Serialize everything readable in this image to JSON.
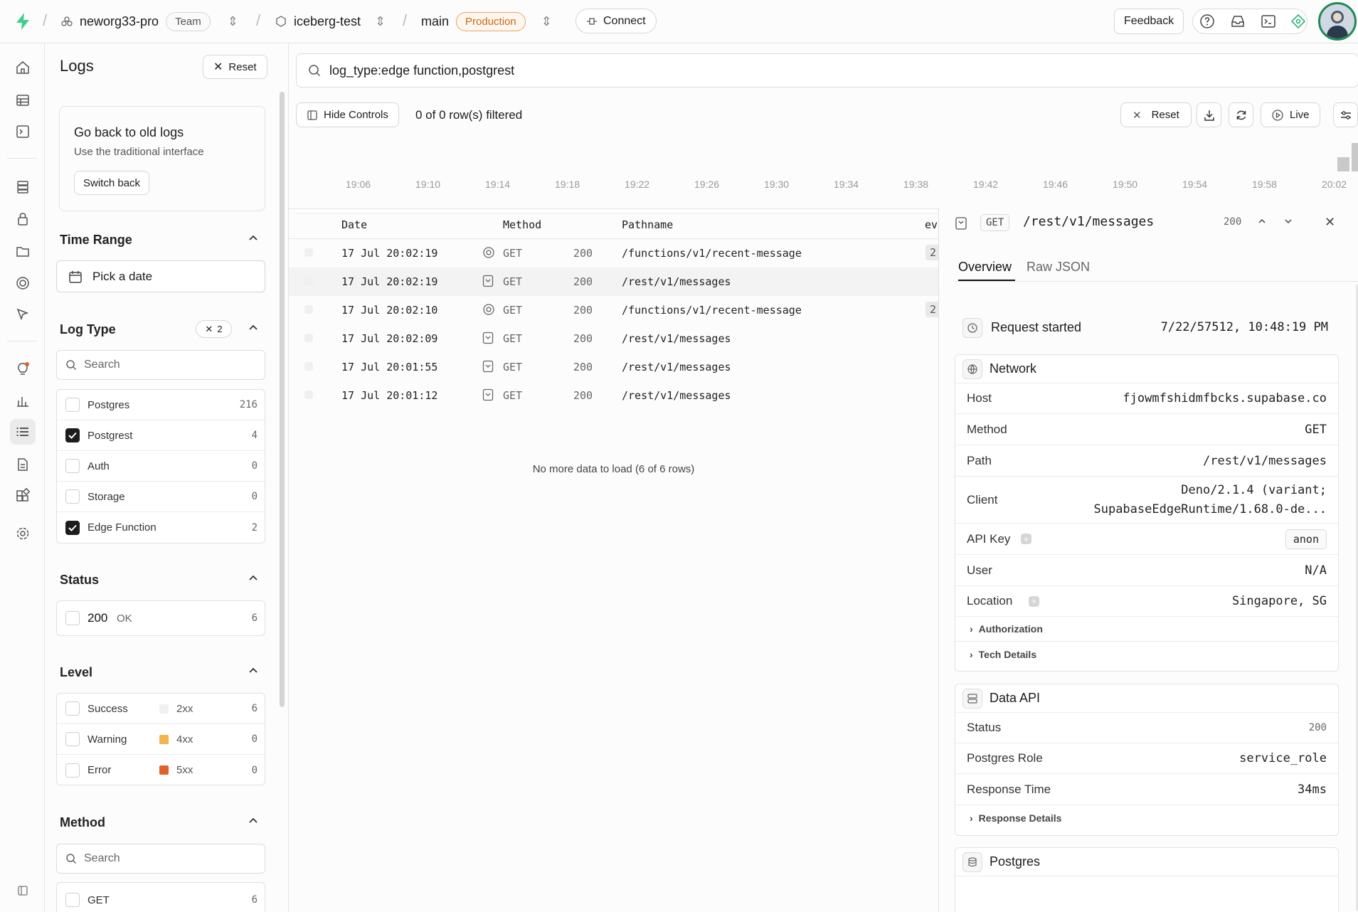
{
  "topbar": {
    "org": "neworg33-pro",
    "org_badge": "Team",
    "project": "iceberg-test",
    "branch": "main",
    "branch_badge": "Production",
    "connect": "Connect",
    "feedback": "Feedback"
  },
  "filters": {
    "title": "Logs",
    "reset": "Reset",
    "old_logs": {
      "title": "Go back to old logs",
      "desc": "Use the traditional interface",
      "button": "Switch back"
    },
    "time_range": {
      "title": "Time Range",
      "picker": "Pick a date"
    },
    "log_type": {
      "title": "Log Type",
      "active_count": "2",
      "search_placeholder": "Search",
      "items": [
        {
          "label": "Postgres",
          "count": "216",
          "checked": false
        },
        {
          "label": "Postgrest",
          "count": "4",
          "checked": true
        },
        {
          "label": "Auth",
          "count": "0",
          "checked": false
        },
        {
          "label": "Storage",
          "count": "0",
          "checked": false
        },
        {
          "label": "Edge Function",
          "count": "2",
          "checked": true
        }
      ]
    },
    "status": {
      "title": "Status",
      "items": [
        {
          "code": "200",
          "text": "OK",
          "count": "6"
        }
      ]
    },
    "level": {
      "title": "Level",
      "items": [
        {
          "label": "Success",
          "range": "2xx",
          "count": "6",
          "color": "#f0f0f0"
        },
        {
          "label": "Warning",
          "range": "4xx",
          "count": "0",
          "color": "#f3b34d"
        },
        {
          "label": "Error",
          "range": "5xx",
          "count": "0",
          "color": "#e0622b"
        }
      ]
    },
    "method": {
      "title": "Method",
      "search_placeholder": "Search",
      "items": [
        {
          "label": "GET",
          "count": "6"
        }
      ]
    }
  },
  "main": {
    "query": "log_type:edge function,postgrest",
    "hide_controls": "Hide Controls",
    "rows_filtered": "0 of 0 row(s) filtered",
    "reset": "Reset",
    "live": "Live",
    "timeline_ticks": [
      "19:06",
      "19:10",
      "19:14",
      "19:18",
      "19:22",
      "19:26",
      "19:30",
      "19:34",
      "19:38",
      "19:42",
      "19:46",
      "19:50",
      "19:54",
      "19:58",
      "20:02"
    ],
    "timeline_bars": [
      1,
      2
    ],
    "columns": {
      "date": "Date",
      "method": "Method",
      "pathname": "Pathname",
      "event": "ev"
    },
    "rows": [
      {
        "date": "17 Jul 20:02:19",
        "type": "edge",
        "method": "GET",
        "status": "200",
        "path": "/functions/v1/recent-message",
        "event": "2"
      },
      {
        "date": "17 Jul 20:02:19",
        "type": "rest",
        "method": "GET",
        "status": "200",
        "path": "/rest/v1/messages",
        "event": ""
      },
      {
        "date": "17 Jul 20:02:10",
        "type": "edge",
        "method": "GET",
        "status": "200",
        "path": "/functions/v1/recent-message",
        "event": "2"
      },
      {
        "date": "17 Jul 20:02:09",
        "type": "rest",
        "method": "GET",
        "status": "200",
        "path": "/rest/v1/messages",
        "event": ""
      },
      {
        "date": "17 Jul 20:01:55",
        "type": "rest",
        "method": "GET",
        "status": "200",
        "path": "/rest/v1/messages",
        "event": ""
      },
      {
        "date": "17 Jul 20:01:12",
        "type": "rest",
        "method": "GET",
        "status": "200",
        "path": "/rest/v1/messages",
        "event": ""
      }
    ],
    "no_more": "No more data to load (6 of 6 rows)"
  },
  "detail": {
    "method": "GET",
    "path": "/rest/v1/messages",
    "status": "200",
    "tabs": [
      "Overview",
      "Raw JSON"
    ],
    "request_started_label": "Request started",
    "request_started_value": "7/22/57512, 10:48:19 PM",
    "network": {
      "title": "Network",
      "host_label": "Host",
      "host": "fjowmfshidmfbcks.supabase.co",
      "method_label": "Method",
      "method": "GET",
      "path_label": "Path",
      "path": "/rest/v1/messages",
      "client_label": "Client",
      "client_line1": "Deno/2.1.4 (variant;",
      "client_line2": "SupabaseEdgeRuntime/1.68.0-de...",
      "apikey_label": "API Key",
      "apikey": "anon",
      "user_label": "User",
      "user": "N/A",
      "location_label": "Location",
      "location": "Singapore, SG",
      "authorization": "Authorization",
      "tech_details": "Tech Details"
    },
    "data_api": {
      "title": "Data API",
      "status_label": "Status",
      "status": "200",
      "role_label": "Postgres Role",
      "role": "service_role",
      "response_label": "Response Time",
      "response": "34ms",
      "response_details": "Response Details"
    },
    "postgres": {
      "title": "Postgres"
    }
  }
}
